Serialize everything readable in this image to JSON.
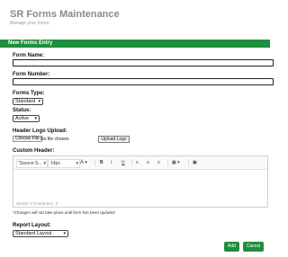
{
  "header": {
    "title": "SR Forms Maintenance",
    "subtitle": "Manage your forms."
  },
  "panel": {
    "title": "New Forms Entry"
  },
  "form": {
    "form_name_label": "Form Name:",
    "form_name_value": "",
    "form_number_label": "Form Number:",
    "form_number_value": "",
    "forms_type_label": "Forms Type:",
    "forms_type_value": "Standard",
    "status_label": "Status:",
    "status_value": "Active",
    "header_logo_label": "Header Logo Upload:",
    "choose_file_label": "Choose File",
    "file_status": "No file chosen",
    "upload_logo_label": "Upload Logo",
    "custom_header_label": "Custom Header:",
    "editor": {
      "font_value": "\"Source S...",
      "size_value": "14px",
      "word_count_text": "Words: 0   Characters: 0"
    },
    "note": "*Changes will not take place until form has been updated",
    "report_layout_label": "Report Layout:",
    "report_layout_value": "Standard Layout"
  },
  "actions": {
    "add_label": "Add",
    "cancel_label": "Cancel"
  },
  "colors": {
    "accent": "#1f8f3e",
    "title_gray": "#8a8a8a"
  }
}
